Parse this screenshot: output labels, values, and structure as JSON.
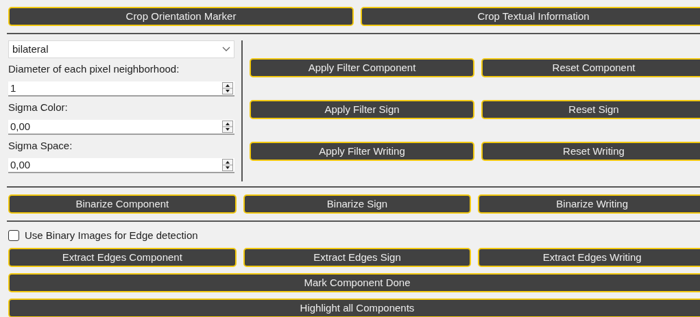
{
  "crop_buttons": [
    "Crop Orientation Marker",
    "Crop Textual Information"
  ],
  "filter": {
    "method": {
      "value": "bilateral"
    },
    "fields": [
      {
        "label": "Diameter of each pixel neighborhood:",
        "value": "1"
      },
      {
        "label": "Sigma Color:",
        "value": "0,00"
      },
      {
        "label": "Sigma Space:",
        "value": "0,00"
      }
    ]
  },
  "filter_buttons": [
    [
      "Apply Filter Component",
      "Reset Component"
    ],
    [
      "Apply Filter Sign",
      "Reset Sign"
    ],
    [
      "Apply Filter Writing",
      "Reset Writing"
    ]
  ],
  "binarize_buttons": [
    "Binarize Component",
    "Binarize Sign",
    "Binarize Writing"
  ],
  "edge_checkbox": {
    "label": "Use Binary Images for Edge detection",
    "checked": false
  },
  "extract_buttons": [
    "Extract Edges Component",
    "Extract Edges Sign",
    "Extract Edges Writing"
  ],
  "wide_buttons": [
    "Mark Component Done",
    "Highlight all Components"
  ]
}
